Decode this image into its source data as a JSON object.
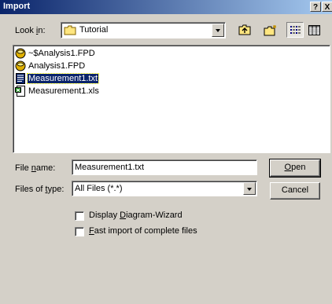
{
  "window": {
    "title": "Import",
    "help_button": "?",
    "close_button": "X"
  },
  "look_in": {
    "label_pre": "Look ",
    "label_accel": "i",
    "label_post": "n:",
    "value": "Tutorial",
    "folder_icon": "folder-icon"
  },
  "toolbar": {
    "up_folder": "up-folder-icon",
    "new_folder": "new-folder-icon",
    "list_view": "list-view-icon",
    "details_view": "details-view-icon"
  },
  "files": [
    {
      "name": "~$Analysis1.FPD",
      "icon": "database-icon",
      "selected": false
    },
    {
      "name": "Analysis1.FPD",
      "icon": "database-icon",
      "selected": false
    },
    {
      "name": "Measurement1.txt",
      "icon": "text-file-icon",
      "selected": true
    },
    {
      "name": "Measurement1.xls",
      "icon": "spreadsheet-icon",
      "selected": false
    }
  ],
  "file_name": {
    "label_pre": "File ",
    "label_accel": "n",
    "label_post": "ame:",
    "value": "Measurement1.txt"
  },
  "file_type": {
    "label_pre": "Files of ",
    "label_accel": "t",
    "label_post": "ype:",
    "value": "All Files (*.*)"
  },
  "buttons": {
    "open_accel": "O",
    "open_rest": "pen",
    "cancel": "Cancel"
  },
  "options": [
    {
      "pre": "Display ",
      "accel": "D",
      "post": "iagram-Wizard",
      "checked": false
    },
    {
      "pre": "",
      "accel": "F",
      "post": "ast import of complete files",
      "checked": false
    }
  ]
}
